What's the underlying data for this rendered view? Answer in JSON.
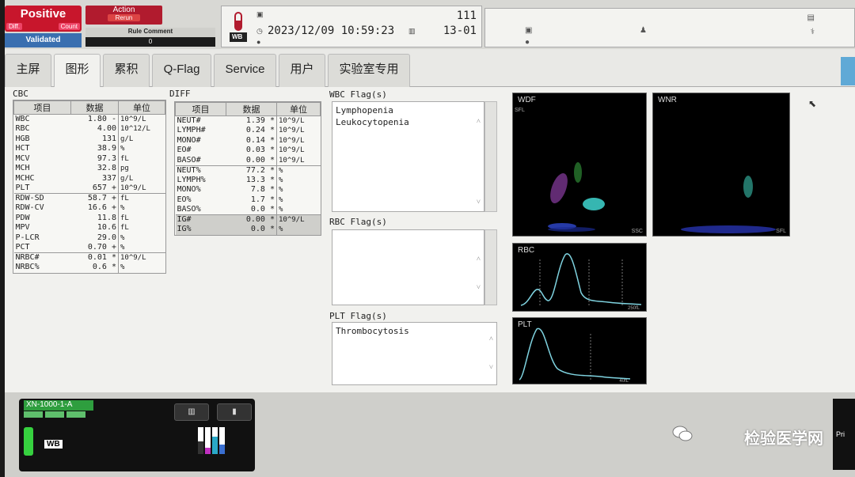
{
  "topbar": {
    "status": "Positive",
    "status_sub_left": "Diff.",
    "status_sub_right": "Count",
    "validated": "Validated",
    "action": "Action",
    "action_sub": "Rerun",
    "rule_comment_label": "Rule Comment",
    "rule_comment_value": "0",
    "sample_type": "WB",
    "sample_number": "111",
    "datetime": "2023/12/09 10:59:23",
    "rack_position": "13-01"
  },
  "tabs": [
    {
      "label": "主屏",
      "active": false
    },
    {
      "label": "图形",
      "active": true
    },
    {
      "label": "累积",
      "active": false
    },
    {
      "label": "Q-Flag",
      "active": false
    },
    {
      "label": "Service",
      "active": false
    },
    {
      "label": "用户",
      "active": false
    },
    {
      "label": "实验室专用",
      "active": false
    }
  ],
  "cbc": {
    "title": "CBC",
    "headers": [
      "项目",
      "数据",
      "单位"
    ],
    "rows": [
      {
        "item": "WBC",
        "value": "1.80",
        "flag": "-",
        "unit": "10^9/L"
      },
      {
        "item": "RBC",
        "value": "4.00",
        "flag": "",
        "unit": "10^12/L"
      },
      {
        "item": "HGB",
        "value": "131",
        "flag": "",
        "unit": "g/L"
      },
      {
        "item": "HCT",
        "value": "38.9",
        "flag": "",
        "unit": "%"
      },
      {
        "item": "MCV",
        "value": "97.3",
        "flag": "",
        "unit": "fL"
      },
      {
        "item": "MCH",
        "value": "32.8",
        "flag": "",
        "unit": "pg"
      },
      {
        "item": "MCHC",
        "value": "337",
        "flag": "",
        "unit": "g/L"
      },
      {
        "item": "PLT",
        "value": "657",
        "flag": "+",
        "unit": "10^9/L"
      },
      {
        "item": "RDW-SD",
        "value": "58.7",
        "flag": "+",
        "unit": "fL"
      },
      {
        "item": "RDW-CV",
        "value": "16.6",
        "flag": "+",
        "unit": "%"
      },
      {
        "item": "PDW",
        "value": "11.8",
        "flag": "",
        "unit": "fL"
      },
      {
        "item": "MPV",
        "value": "10.6",
        "flag": "",
        "unit": "fL"
      },
      {
        "item": "P-LCR",
        "value": "29.0",
        "flag": "",
        "unit": "%"
      },
      {
        "item": "PCT",
        "value": "0.70",
        "flag": "+",
        "unit": "%"
      },
      {
        "item": "NRBC#",
        "value": "0.01",
        "flag": "*",
        "unit": "10^9/L"
      },
      {
        "item": "NRBC%",
        "value": "0.6",
        "flag": "*",
        "unit": "%"
      }
    ]
  },
  "diff": {
    "title": "DIFF",
    "headers": [
      "项目",
      "数据",
      "单位"
    ],
    "rows": [
      {
        "item": "NEUT#",
        "value": "1.39",
        "flag": "*",
        "unit": "10^9/L"
      },
      {
        "item": "LYMPH#",
        "value": "0.24",
        "flag": "*",
        "unit": "10^9/L"
      },
      {
        "item": "MONO#",
        "value": "0.14",
        "flag": "*",
        "unit": "10^9/L"
      },
      {
        "item": "EO#",
        "value": "0.03",
        "flag": "*",
        "unit": "10^9/L"
      },
      {
        "item": "BASO#",
        "value": "0.00",
        "flag": "*",
        "unit": "10^9/L"
      },
      {
        "item": "NEUT%",
        "value": "77.2",
        "flag": "*",
        "unit": "%"
      },
      {
        "item": "LYMPH%",
        "value": "13.3",
        "flag": "*",
        "unit": "%"
      },
      {
        "item": "MONO%",
        "value": "7.8",
        "flag": "*",
        "unit": "%"
      },
      {
        "item": "EO%",
        "value": "1.7",
        "flag": "*",
        "unit": "%"
      },
      {
        "item": "BASO%",
        "value": "0.0",
        "flag": "*",
        "unit": "%"
      },
      {
        "item": "IG#",
        "value": "0.00",
        "flag": "*",
        "unit": "10^9/L"
      },
      {
        "item": "IG%",
        "value": "0.0",
        "flag": "*",
        "unit": "%"
      }
    ]
  },
  "flags": {
    "wbc_title": "WBC Flag(s)",
    "wbc": [
      "Lymphopenia",
      "Leukocytopenia"
    ],
    "rbc_title": "RBC Flag(s)",
    "rbc": [],
    "plt_title": "PLT Flag(s)",
    "plt": [
      "Thrombocytosis"
    ]
  },
  "plots": {
    "wdf": {
      "label": "WDF",
      "xaxis": "SSC",
      "yaxis": "SFL"
    },
    "wnr": {
      "label": "WNR",
      "xaxis": "SFL"
    },
    "rbc": {
      "label": "RBC",
      "xmax": "250fL"
    },
    "plt": {
      "label": "PLT",
      "xmax": "40fL"
    }
  },
  "bottom": {
    "device_name": "XN-1000-1-A",
    "device_mode": "WB",
    "watermark": "检验医学网",
    "print_label": "Pri"
  },
  "colors": {
    "positive": "#c8162c",
    "validated": "#3a6fb0",
    "device_led": "#36d13f",
    "plot_curve": "#7fd3e0"
  }
}
